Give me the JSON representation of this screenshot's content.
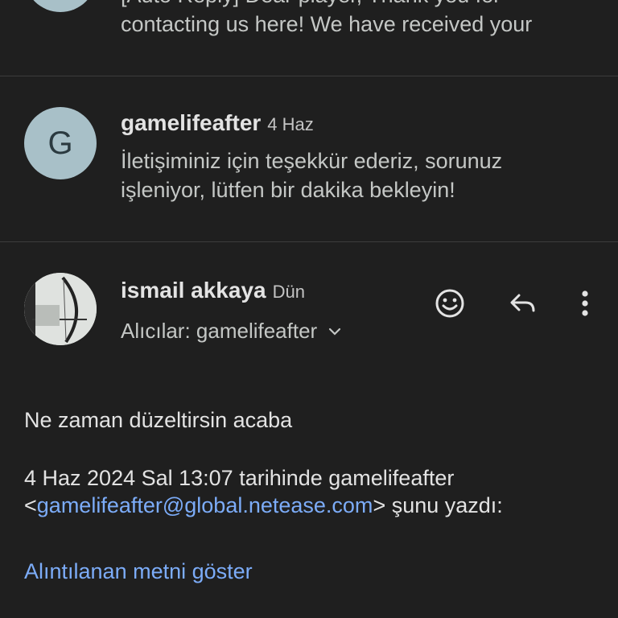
{
  "messages": [
    {
      "snippet_line1": "[Auto Reply] Dear player, Thank you for",
      "snippet_line2": "contacting us here! We have received your"
    },
    {
      "avatar_letter": "G",
      "sender": "gamelifeafter",
      "date": "4 Haz",
      "snippet_line1": "İletişiminiz için teşekkür ederiz, sorunuz",
      "snippet_line2": "işleniyor, lütfen bir dakika bekleyin!"
    }
  ],
  "open_message": {
    "sender": "ismail akkaya",
    "date": "Dün",
    "recipients": "Alıcılar: gamelifeafter",
    "body": "Ne zaman düzeltirsin acaba",
    "quote_header_line1": "4 Haz 2024 Sal 13:07 tarihinde gamelifeafter",
    "quote_email_open": "<",
    "quote_email": "gamelifeafter@global.netease.com",
    "quote_email_close": "> şunu yazdı:",
    "show_quoted": "Alıntılanan metni göster"
  },
  "icons": {
    "emoji": "emoji-icon",
    "reply": "reply-icon",
    "more": "more-vert-icon",
    "chevron": "chevron-down-icon"
  },
  "colors": {
    "background": "#1f1f1f",
    "link": "#7cacf8",
    "avatar": "#a8c0c8"
  }
}
